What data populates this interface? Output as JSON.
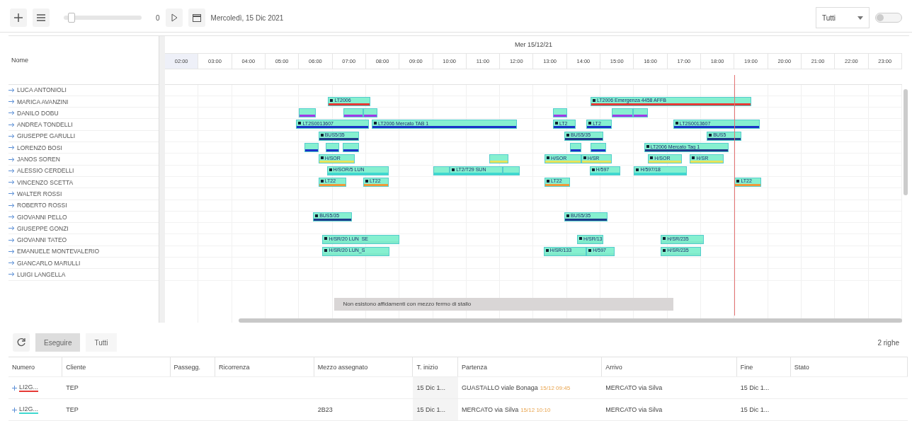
{
  "toolbar": {
    "zoom_slider": {
      "level": 0.05
    },
    "counter": "0",
    "date": "Mercoledì, 15 Dic 2021",
    "filter": {
      "value": "Tutti"
    },
    "toggle": {
      "on": false
    }
  },
  "gantt": {
    "name_header": "Nome",
    "day": "Mer 15/12/21",
    "hours": [
      "02:00",
      "03:00",
      "04:00",
      "05:00",
      "06:00",
      "07:00",
      "08:00",
      "09:00",
      "10:00",
      "11:00",
      "12:00",
      "13:00",
      "14:00",
      "15:00",
      "16:00",
      "17:00",
      "18:00",
      "19:00",
      "20:00",
      "21:00",
      "22:00",
      "23:00"
    ],
    "rows": [
      {
        "name": "LUCA ANTONIOLI",
        "bars": []
      },
      {
        "name": "MARICA AVANZINI",
        "bars": [
          {
            "color": "#e53935",
            "label": "LT2006"
          },
          {
            "color": "#e53935",
            "label": "LT2006 Emergenza 4458 AFFB"
          }
        ]
      },
      {
        "name": "DANILO DOBU",
        "bars": [
          {
            "color": "#a23be8"
          },
          {
            "color": "#a23be8"
          },
          {
            "color": "#a23be8"
          },
          {
            "color": "#a23be8"
          },
          {
            "color": "#a23be8"
          },
          {
            "color": "#a23be8"
          }
        ]
      },
      {
        "name": "ANDREA TONDELLI",
        "bars": [
          {
            "color": "#1a33c8",
            "label": "LT2S0013607"
          },
          {
            "color": "#1a33c8",
            "label": "LT2006 Mercato TAB 1"
          },
          {
            "color": "#1a33c8",
            "label": "LT2"
          },
          {
            "color": "#1a33c8",
            "label": "LT2"
          },
          {
            "color": "#1a33c8",
            "label": "LT2S0013607"
          }
        ]
      },
      {
        "name": "GIUSEPPE GARULLI",
        "bars": [
          {
            "color": "#1f3a8a",
            "label": "BUS5/35"
          },
          {
            "color": "#1f3a8a",
            "label": "BUS5/35"
          },
          {
            "color": "#1f3a8a",
            "label": "BUS5"
          }
        ]
      },
      {
        "name": "LORENZO BOSI",
        "bars": [
          {
            "color": "#1a33c8"
          },
          {
            "color": "#1a33c8"
          },
          {
            "color": "#1a33c8"
          },
          {
            "color": "#1a33c8"
          },
          {
            "color": "#1a33c8"
          },
          {
            "color": "#1f3a8a",
            "label": "LT2006 Mercato Tag 1"
          }
        ]
      },
      {
        "name": "JANOS SOREN",
        "bars": [
          {
            "color": "#e8e35a",
            "label": "H/SOR"
          },
          {
            "color": "#e8e35a"
          },
          {
            "color": "#e8e35a",
            "label": "H/SOR"
          },
          {
            "color": "#e8e35a",
            "label": "H/SR"
          },
          {
            "color": "#e8e35a",
            "label": "H/SOR"
          },
          {
            "color": "#e8e35a",
            "label": "H/SR"
          }
        ]
      },
      {
        "name": "ALESSIO CERDELLI",
        "bars": [
          {
            "color": "#3fd9d0",
            "label": "H/SOR/5 LUN"
          },
          {
            "color": "#3fd9d0"
          },
          {
            "color": "#3fd9d0",
            "label": "LT2/T29 SUN"
          },
          {
            "color": "#3fd9d0"
          },
          {
            "color": "#3fd9d0",
            "label": "H/597"
          },
          {
            "color": "#3fd9d0",
            "label": "H/597/18"
          }
        ]
      },
      {
        "name": "VINCENZO SCETTA",
        "bars": [
          {
            "color": "#f09a3a",
            "label": "LT22"
          },
          {
            "color": "#f09a3a",
            "label": "LT22"
          },
          {
            "color": "#f09a3a",
            "label": "LT22"
          },
          {
            "color": "#f09a3a",
            "label": "LT22"
          }
        ]
      },
      {
        "name": "WALTER ROSSI",
        "bars": []
      },
      {
        "name": "ROBERTO ROSSI",
        "bars": []
      },
      {
        "name": "GIOVANNI PELLO",
        "bars": [
          {
            "color": "#1f3a8a",
            "label": "BUS5/35"
          },
          {
            "color": "#1f3a8a",
            "label": "BUS5/35"
          }
        ]
      },
      {
        "name": "GIUSEPPE GONZI",
        "bars": []
      },
      {
        "name": "GIOVANNI TATEO",
        "bars": [
          {
            "color": "#7fe9c9",
            "label": "H/SR/20 LUN_SE"
          },
          {
            "color": "#7fe9c9",
            "label": "H/SR/13"
          },
          {
            "color": "#7fe9c9",
            "label": "H/SR/235"
          }
        ]
      },
      {
        "name": "EMANUELE MONTEVALERIO",
        "bars": [
          {
            "color": "#7fe9c9",
            "label": "H/SR/20 LUN_S"
          },
          {
            "color": "#7fe9c9",
            "label": "H/SR/133"
          },
          {
            "color": "#7fe9c9",
            "label": "H/597"
          },
          {
            "color": "#7fe9c9",
            "label": "H/SR/235"
          }
        ]
      },
      {
        "name": "GIANCARLO MARULLI",
        "bars": []
      },
      {
        "name": "LUIGI LANGELLA",
        "bars": []
      }
    ],
    "tooltip": "Non esistono affidamenti con mezzo fermo di stallo"
  },
  "bottom": {
    "tabs": [
      {
        "label": "Eseguire",
        "selected": true
      },
      {
        "label": "Tutti",
        "selected": false
      }
    ],
    "count": "2 righe",
    "columns": [
      "Numero",
      "Cliente",
      "Passegg.",
      "Ricorrenza",
      "Mezzo assegnato",
      "T. inizio",
      "Partenza",
      "Arrivo",
      "Fine",
      "Stato"
    ],
    "rows": [
      {
        "color": "#e53935",
        "cells": [
          "LI2G...",
          "TEP",
          "",
          "",
          "",
          "15 Dic 1...",
          "GUASTALLO viale Bonaga",
          "MERCATO via Silva",
          "15 Dic 1...",
          ""
        ],
        "note": "15/12 09:45"
      },
      {
        "color": "#3fd9d0",
        "cells": [
          "LI2G...",
          "TEP",
          "",
          "",
          "2B23",
          "15 Dic 1...",
          "MERCATO via Silva",
          "MERCATO via Silva",
          "15 Dic 1...",
          ""
        ],
        "note": "15/12 10:10"
      }
    ]
  }
}
